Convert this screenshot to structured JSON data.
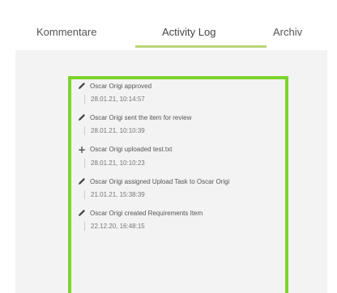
{
  "tabs": [
    {
      "label": "Kommentare"
    },
    {
      "label": "Activity Log"
    },
    {
      "label": "Archiv"
    }
  ],
  "active_tab": "Activity Log",
  "accent_color": "#7dd32a",
  "log": [
    {
      "icon": "pencil-icon",
      "message": "Oscar Origi approved",
      "timestamp": "28.01.21, 10:14:57"
    },
    {
      "icon": "pencil-icon",
      "message": "Oscar Origi sent the item for review",
      "timestamp": "28.01.21, 10:10:39"
    },
    {
      "icon": "plus-icon",
      "message": "Oscar Origi uploaded test.txt",
      "timestamp": "28.01.21, 10:10:23"
    },
    {
      "icon": "pencil-icon",
      "message": "Oscar Origi assigned Upload Task to Oscar Origi",
      "timestamp": "21.01.21, 15:38:39"
    },
    {
      "icon": "pencil-icon",
      "message": "Oscar Origi created Requirements Item",
      "timestamp": "22.12.20, 16:48:15"
    }
  ]
}
